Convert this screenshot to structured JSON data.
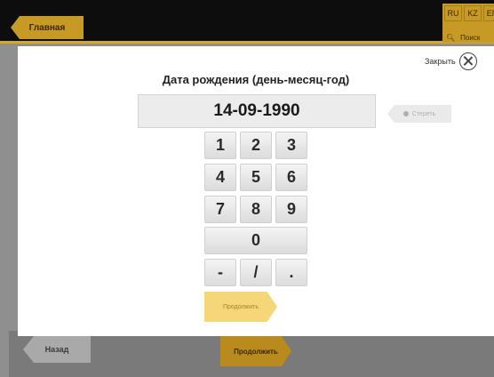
{
  "background": {
    "home_label": "Главная",
    "languages": [
      "RU",
      "KZ",
      "EN"
    ],
    "search_label": "Поиск",
    "back_label": "Назад",
    "continue_label": "Продолжить",
    "accent": "#c79a26"
  },
  "modal": {
    "close_label": "Закрыть",
    "title": "Дата рождения (день-месяц-год)",
    "date_value": "14-09-1990",
    "clear_label": "Стереть",
    "keypad": {
      "row1": [
        "1",
        "2",
        "3"
      ],
      "row2": [
        "4",
        "5",
        "6"
      ],
      "row3": [
        "7",
        "8",
        "9"
      ],
      "zero": "0",
      "row5": [
        "-",
        "/",
        "."
      ]
    },
    "continue_label": "Продолжить"
  }
}
